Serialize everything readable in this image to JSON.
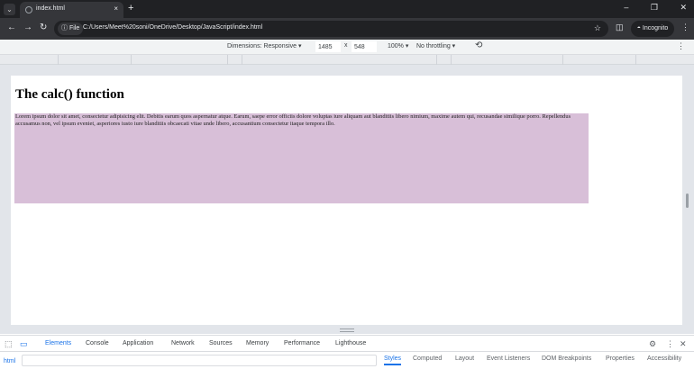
{
  "browser": {
    "tab_title": "index.html",
    "tab_close": "×",
    "new_tab": "+",
    "url_scheme_label": "File",
    "url": "C:/Users/Meet%20soni/OneDrive/Desktop/JavaScript/index.html",
    "profile_label": "Incognito"
  },
  "device_toolbar": {
    "dimensions_label": "Dimensions: Responsive ▾",
    "width_value": "1485",
    "height_value": "548",
    "size_separator": "x",
    "zoom_label": "100% ▾",
    "throttle_label": "No throttling ▾"
  },
  "page": {
    "heading": "The calc() function",
    "paragraph": "Lorem ipsum dolor sit amet, consectetur adipisicing elit. Debitis earum quos aspernatur atque. Earum, saepe error officiis dolore voluptas iure aliquam aut blanditiis libero nimium, maxime autem qui, recusandae similique porro. Repellendus accusamus non, vel ipsum eveniet, asperiores iusto iure blanditiis obcaecati vitae unde libero, accusantium consectetur itaque tempora illo."
  },
  "devtools": {
    "tabs": [
      "Elements",
      "Console",
      "Application",
      "Network",
      "Sources",
      "Memory",
      "Performance",
      "Lighthouse"
    ],
    "breadcrumb": "html",
    "panel_tabs": [
      "Styles",
      "Computed",
      "Layout",
      "Event Listeners",
      "DOM Breakpoints",
      "Properties",
      "Accessibility"
    ]
  },
  "colors": {
    "calc_box": "#d8bfd8",
    "accent": "#1a73e8"
  },
  "icons": [
    "tab-search-icon",
    "back-arrow-icon",
    "forward-arrow-icon",
    "reload-icon",
    "info-icon",
    "star-icon",
    "side-panel-icon",
    "incognito-icon",
    "menu-icon",
    "rotate-icon",
    "inspect-icon",
    "device-toggle-icon",
    "settings-icon",
    "close-icon"
  ]
}
